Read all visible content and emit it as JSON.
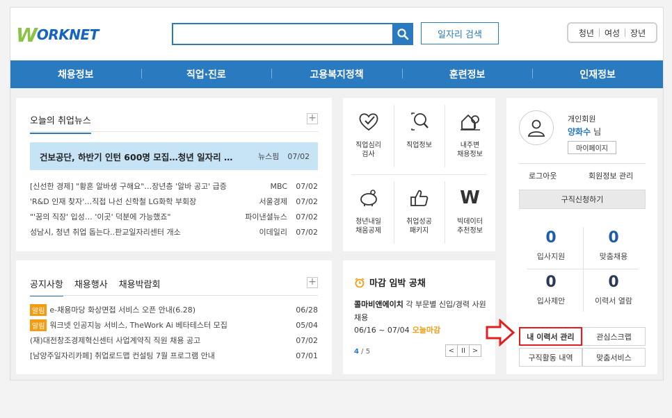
{
  "logo": {
    "w": "W",
    "text": "ORKNET"
  },
  "search": {
    "value": "",
    "placeholder": "",
    "icon": "search-icon",
    "job_search_label": "일자리 검색"
  },
  "segments": [
    "청년",
    "여성",
    "장년"
  ],
  "nav": [
    "채용정보",
    "직업·진로",
    "고용복지정책",
    "훈련정보",
    "인재정보"
  ],
  "news": {
    "title": "오늘의 취업뉴스",
    "headline": {
      "title": "건보공단, 하반기 인턴 600명 모집…청년 일자리 …",
      "source": "뉴스핌",
      "date": "07/02"
    },
    "items": [
      {
        "title": "[신선한 경제] \"황혼 알바생 구해요\"…장년층 '알바 공고' 급증",
        "source": "MBC",
        "date": "07/02"
      },
      {
        "title": "'R&D 인재 찾자'…직접 나선 신학철 LG화학 부회장",
        "source": "서울경제",
        "date": "07/02"
      },
      {
        "title": "\"'꿈의 직장' 입성… '이곳' 덕분에 가능했죠\"",
        "source": "파이낸셜뉴스",
        "date": "07/02"
      },
      {
        "title": "성남시, 청년 취업 돕는다..판교일자리센터 개소",
        "source": "이데일리",
        "date": "07/02"
      }
    ]
  },
  "notice": {
    "tabs": [
      "공지사항",
      "채용행사",
      "채용박람회"
    ],
    "items": [
      {
        "badge": "알림",
        "title": "e-채용마당 화상면접 서비스 오픈 안내(6.28)",
        "date": "06/28"
      },
      {
        "badge": "알림",
        "title": "워크넷 인공지능 서비스, TheWork Ai 베타테스터 모집",
        "date": "05/04"
      },
      {
        "badge": "",
        "title": "(재)대전창조경제혁신센터 사업계약직 직원 채용 공고",
        "date": "07/02"
      },
      {
        "badge": "",
        "title": "[남양주일자리카페] 취업로드맵 컨설팅 7월 프로그램 안내",
        "date": "07/01"
      }
    ]
  },
  "quick": [
    {
      "icon": "heart-check-icon",
      "line1": "직업심리",
      "line2": "검사"
    },
    {
      "icon": "magnifier-icon",
      "line1": "직업정보",
      "line2": ""
    },
    {
      "icon": "house-location-icon",
      "line1": "내주변",
      "line2": "채용정보"
    },
    {
      "icon": "piggy-bank-icon",
      "line1": "청년내일",
      "line2": "채움공제"
    },
    {
      "icon": "thumbs-up-icon",
      "line1": "취업성공",
      "line2": "패키지"
    },
    {
      "icon": "w-letter-icon",
      "glyph": "W",
      "line1": "빅데이터",
      "line2": "추천정보"
    }
  ],
  "deadline": {
    "title": "마감 임박 공채",
    "company": "콜마비앤에이치",
    "desc": "각 부문별 신입/경력 사원 채용",
    "period": "06/16 ~ 07/04",
    "status": "오늘마감",
    "page_current": "4",
    "page_total": "/ 5",
    "controls": [
      "<",
      "II",
      ">"
    ]
  },
  "user": {
    "type": "개인회원",
    "name": "양화수",
    "suffix": "님",
    "mypage": "마이페이지",
    "logout": "로그아웃",
    "member_mgmt": "회원정보 관리",
    "apply": "구직신청하기",
    "stats": [
      {
        "value": "0",
        "label": "입사지원"
      },
      {
        "value": "0",
        "label": "맞춤채용"
      },
      {
        "value": "0",
        "label": "입사제안"
      },
      {
        "value": "0",
        "label": "이력서 열람"
      }
    ],
    "buttons": [
      "내 이력서 관리",
      "관심스크랩",
      "구직활동 내역",
      "맞춤서비스"
    ]
  },
  "colors": {
    "brand_blue": "#2a7abf",
    "logo_green": "#8bc34a",
    "accent_orange": "#f39c12",
    "highlight_red": "#e02020"
  }
}
